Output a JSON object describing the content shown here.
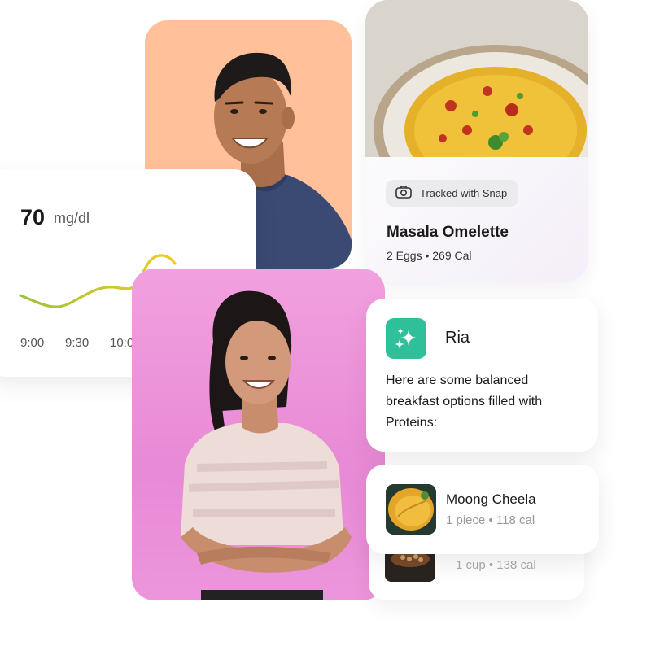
{
  "glucose": {
    "value": "70",
    "unit": "mg/dl",
    "times": [
      "9:00",
      "9:30",
      "10:0"
    ]
  },
  "food_card": {
    "chip_icon": "camera-icon",
    "chip_label": "Tracked with Snap",
    "title": "Masala Omelette",
    "subtitle": "2 Eggs • 269 Cal"
  },
  "assistant": {
    "icon": "sparkles-icon",
    "name": "Ria",
    "message": "Here are some balanced breakfast options filled with Proteins:"
  },
  "suggestions": [
    {
      "name": "Moong Cheela",
      "detail": "1 piece • 118 cal"
    },
    {
      "detail": "1 cup • 138 cal"
    }
  ],
  "colors": {
    "man_bg": "#FFC09A",
    "woman_bg": "#EC95DC",
    "ria_accent": "#2FC09A"
  }
}
